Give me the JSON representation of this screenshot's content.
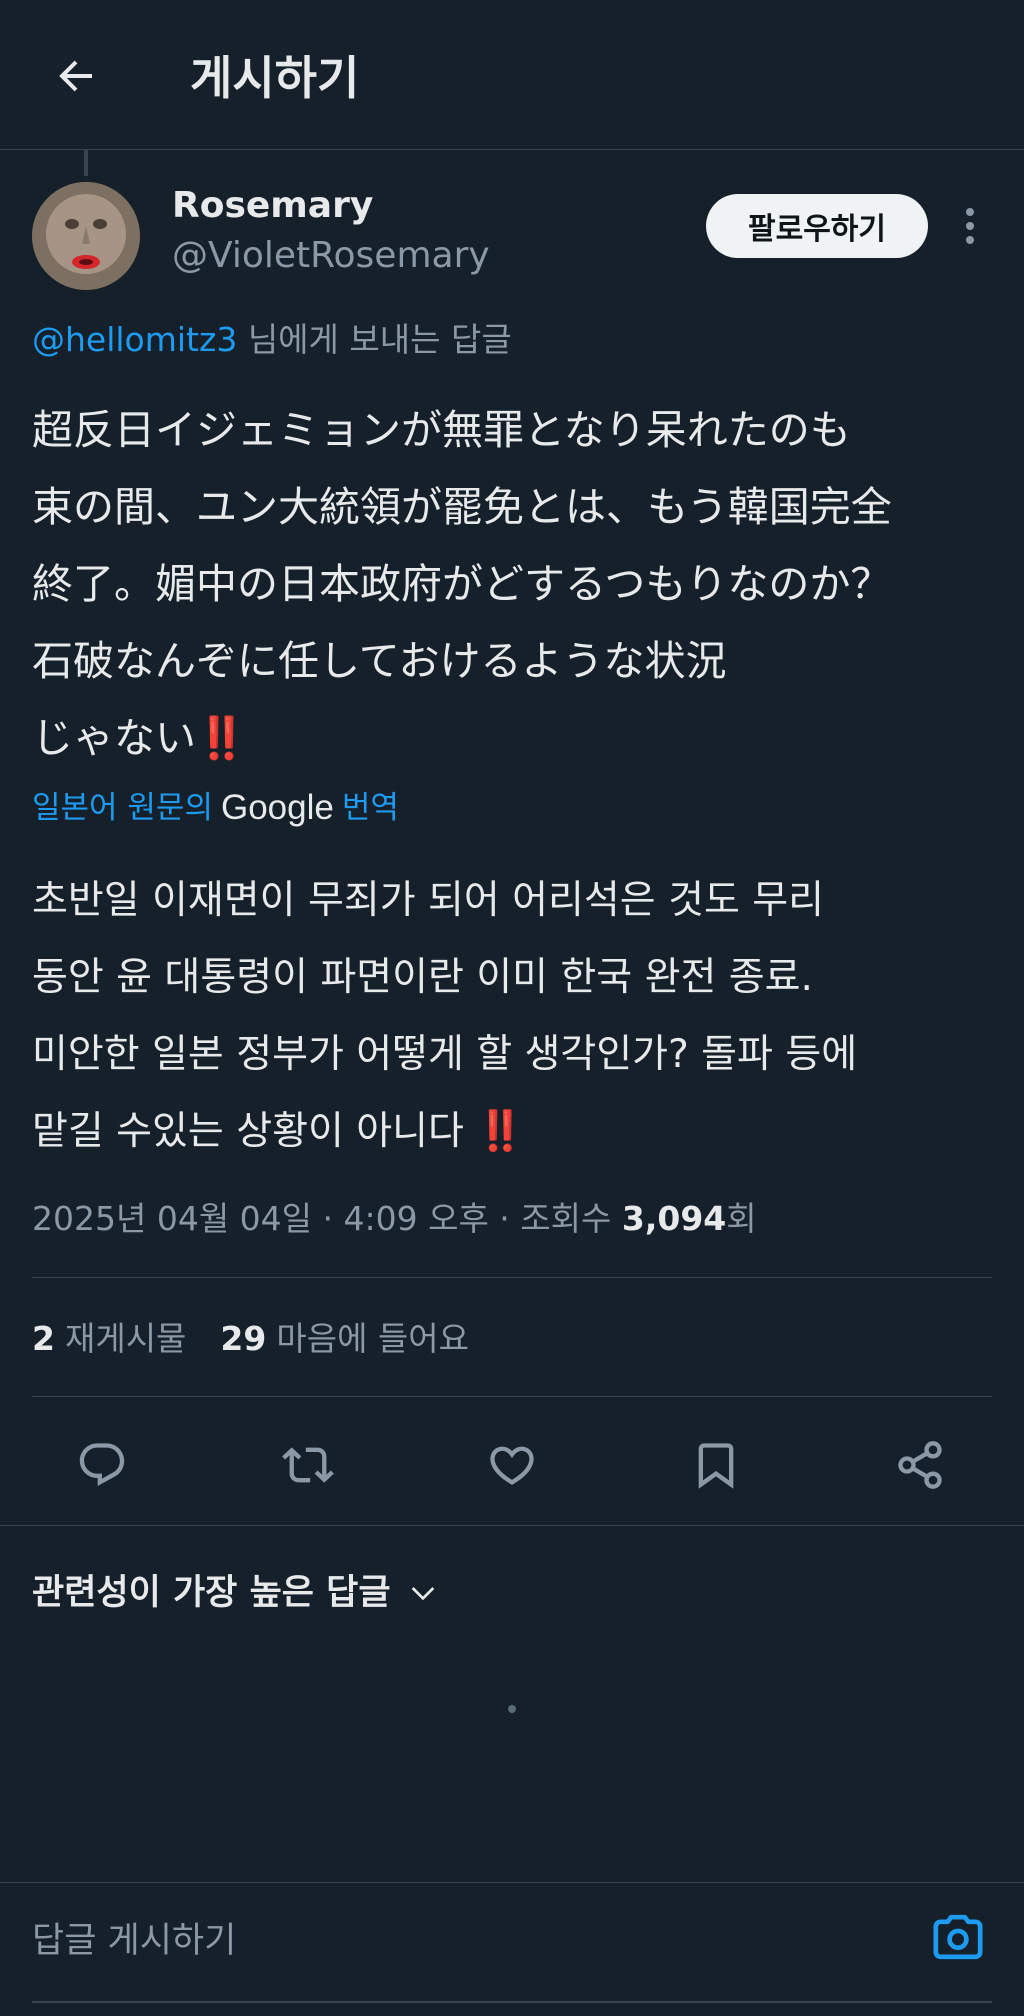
{
  "header": {
    "title": "게시하기",
    "back_icon": "arrow-left-icon"
  },
  "post": {
    "author_name": "Rosemary",
    "author_handle": "@VioletRosemary",
    "follow_label": "팔로우하기",
    "reply_to_handle": "@hellomitz3",
    "reply_to_suffix": " 님에게 보내는 답글",
    "original_text": "超反日イジェミョンが無罪となり呆れたのも\n束の間、ユン大統領が罷免とは、もう韓国完全\n終了。媚中の日本政府がどするつもりなのか？\n石破なんぞに任しておけるような状況\nじゃない",
    "original_emoji": "‼️",
    "translate_prefix": "일본어 원문의",
    "translate_brand": "Google",
    "translate_suffix": "번역",
    "translated_text": "초반일 이재면이 무죄가 되어 어리석은 것도 무리\n동안 윤 대통령이 파면이란 이미 한국 완전 종료.\n미안한 일본 정부가 어떻게 할 생각인가? 돌파 등에\n맡길 수있는 상황이 아니다 ",
    "translated_emoji": "‼️",
    "timestamp": "2025년 04월 04일 · 4:09 오후 · 조회수 ",
    "views_count": "3,094",
    "views_suffix": "회"
  },
  "stats": {
    "reposts_count": "2",
    "reposts_label": "재게시물",
    "likes_count": "29",
    "likes_label": "마음에 들어요"
  },
  "actions": [
    "reply-icon",
    "repost-icon",
    "like-icon",
    "bookmark-icon",
    "share-icon"
  ],
  "replies": {
    "sort_label": "관련성이 가장 높은 답글"
  },
  "compose": {
    "placeholder": "답글 게시하기"
  },
  "colors": {
    "background": "#15202b",
    "accent": "#1d9bf0",
    "text": "#e7e9ea",
    "muted": "#8b98a5",
    "divider": "#38444d",
    "emoji_red": "#e0202c"
  }
}
